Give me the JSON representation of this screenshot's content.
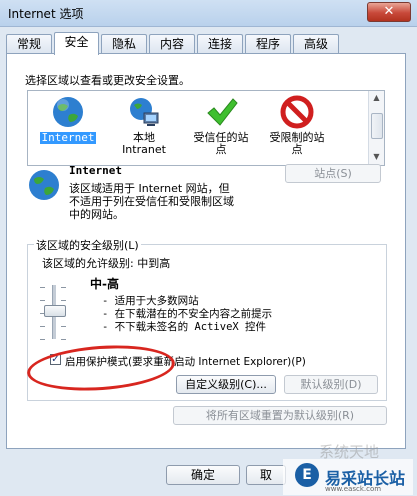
{
  "window": {
    "title": "Internet 选项",
    "close_label": "✕"
  },
  "tabs": [
    {
      "label": "常规"
    },
    {
      "label": "安全"
    },
    {
      "label": "隐私"
    },
    {
      "label": "内容"
    },
    {
      "label": "连接"
    },
    {
      "label": "程序"
    },
    {
      "label": "高级"
    }
  ],
  "security": {
    "instruction": "选择区域以查看或更改安全设置。",
    "zones": [
      {
        "label": "Internet",
        "icon": "globe-icon"
      },
      {
        "label": "本地\nIntranet",
        "icon": "network-icon"
      },
      {
        "label": "受信任的站\n点",
        "icon": "checkmark-icon"
      },
      {
        "label": "受限制的站\n点",
        "icon": "no-entry-icon"
      }
    ],
    "selected_zone_title": "Internet",
    "selected_zone_desc": "该区域适用于 Internet 网站，但\n不适用于列在受信任和受限制区域\n中的网站。",
    "sites_button": "站点(S)",
    "level_group_title": "该区域的安全级别(L)",
    "allowed_level": "该区域的允许级别: 中到高",
    "level_name": "中-高",
    "level_items": [
      "- 适用于大多数网站",
      "- 在下载潜在的不安全内容之前提示",
      "- 不下载未签名的 ActiveX 控件"
    ],
    "protected_mode_label": "启用保护模式(要求重新启动 Internet Explorer)(P)",
    "protected_mode_checked": true,
    "custom_level_button": "自定义级别(C)...",
    "default_level_button": "默认级别(D)",
    "reset_all_button": "将所有区域重置为默认级别(R)"
  },
  "footer": {
    "ok_button": "确定",
    "cancel_button": "取"
  },
  "watermark": {
    "text": "易采站长站",
    "url": "www.easck.com",
    "faint": "系统天地",
    "logo": "E"
  },
  "colors": {
    "selection": "#3399ff",
    "annotation": "#d8261f"
  }
}
